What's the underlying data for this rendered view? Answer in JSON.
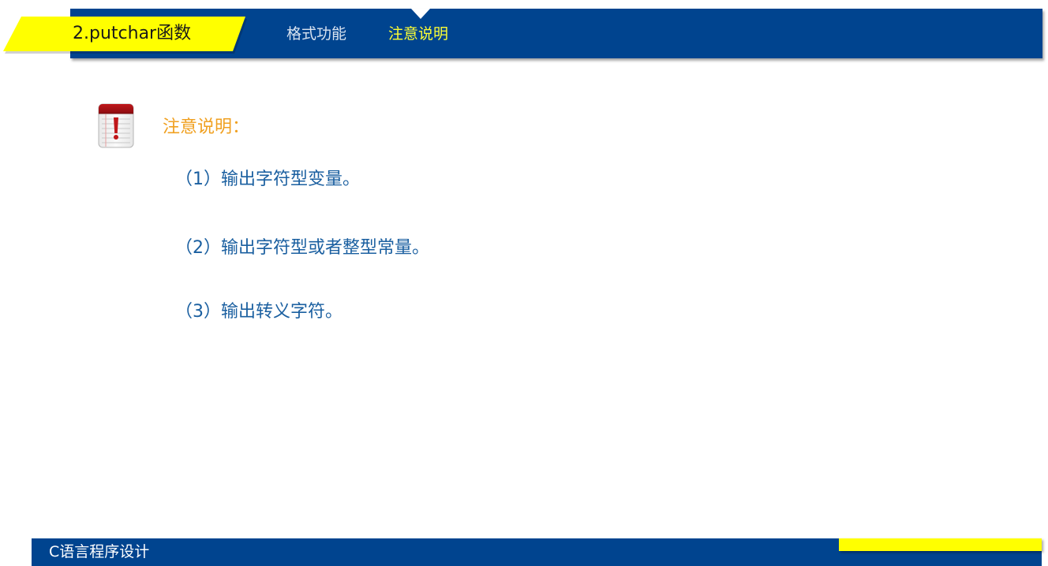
{
  "header": {
    "title": "2.putchar函数",
    "tabs": [
      {
        "label": "格式功能",
        "active": false
      },
      {
        "label": "注意说明",
        "active": true
      }
    ]
  },
  "content": {
    "icon": "notepad-alert-icon",
    "heading": "注意说明：",
    "points": [
      "（1）输出字符型变量。",
      "（2）输出字符型或者整型常量。",
      "（3）输出转义字符。"
    ]
  },
  "footer": {
    "course_name": "C语言程序设计"
  },
  "colors": {
    "brand_blue": "#00448f",
    "accent_yellow": "#ffff00",
    "heading_orange": "#f0a020",
    "point_blue": "#1a5fa0"
  }
}
